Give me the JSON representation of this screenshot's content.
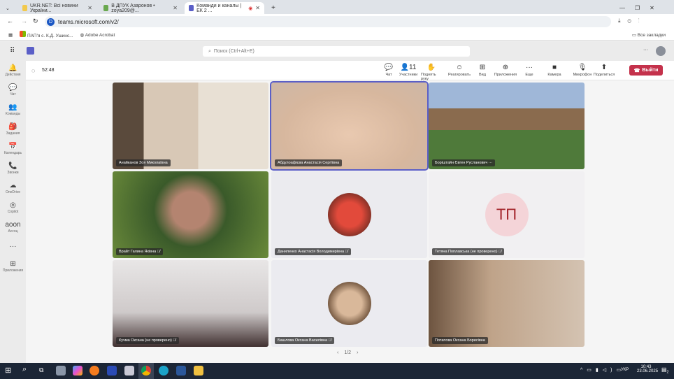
{
  "browser": {
    "tabs": [
      {
        "label": "UKR.NET: Всі новини України..."
      },
      {
        "label": "В ДПУК Азаронов • zoya209@..."
      },
      {
        "label": "Команди и каналы | ЕК 2 ..."
      }
    ],
    "new_tab": "+",
    "url": "teams.microsoft.com/v2/",
    "bookmarks": [
      "ПАП'я с. К.Д. Ушинс...",
      "Adobe Acrobat"
    ],
    "all_bookmarks": "Все закладки"
  },
  "teams": {
    "search_placeholder": "Поиск (Ctrl+Alt+E)",
    "more": "···"
  },
  "rail": [
    {
      "icon": "🔔",
      "label": "Действия"
    },
    {
      "icon": "💬",
      "label": "Чат"
    },
    {
      "icon": "👥",
      "label": "Команды"
    },
    {
      "icon": "🎒",
      "label": "Задания"
    },
    {
      "icon": "📅",
      "label": "Календарь"
    },
    {
      "icon": "📞",
      "label": "Звонки"
    },
    {
      "icon": "☁",
      "label": "OneDrive"
    },
    {
      "icon": "◎",
      "label": "Copilot"
    },
    {
      "icon": "aoon",
      "label": "Ассоц"
    },
    {
      "icon": "···",
      "label": ""
    },
    {
      "icon": "⊞",
      "label": "Приложения"
    }
  ],
  "meeting": {
    "timer": "52:48",
    "controls": [
      {
        "icon": "💬",
        "label": "Чат"
      },
      {
        "icon": "👤11",
        "label": "Участники"
      },
      {
        "icon": "✋",
        "label": "Поднять руку"
      },
      {
        "icon": "☺",
        "label": "Реагировать"
      },
      {
        "icon": "⊞",
        "label": "Вид"
      },
      {
        "icon": "⊕",
        "label": "Приложения"
      },
      {
        "icon": "···",
        "label": "Еще"
      },
      {
        "icon": "■",
        "label": "Камера"
      },
      {
        "icon": "🎙",
        "label": "Микрофон"
      },
      {
        "icon": "⬆",
        "label": "Поделиться"
      }
    ],
    "leave": "Выйти",
    "participants": [
      {
        "name": "Анайканов Зоя Миколаївна",
        "muted": false
      },
      {
        "name": "Абдулоафієва Анастасія Сергіївна",
        "muted": false
      },
      {
        "name": "Боріштайн Євген Русланович ···",
        "muted": false
      },
      {
        "name": "Врайт Галина Яківна",
        "muted": true
      },
      {
        "name": "Даниленко Анастасія Володимирівна",
        "muted": true
      },
      {
        "name": "Тетяна Поплавська (не проверено)",
        "muted": true,
        "initials": "ТП"
      },
      {
        "name": "Кучма Оксана (не проверено)",
        "muted": true
      },
      {
        "name": "Башлова Оксана Василівна",
        "muted": true
      },
      {
        "name": "Потапова Оксана Борисівна",
        "muted": false
      }
    ],
    "pager": "1/2"
  },
  "taskbar": {
    "lang": "УКР",
    "time": "10:43",
    "date": "23.06.2025",
    "notif": "2"
  }
}
